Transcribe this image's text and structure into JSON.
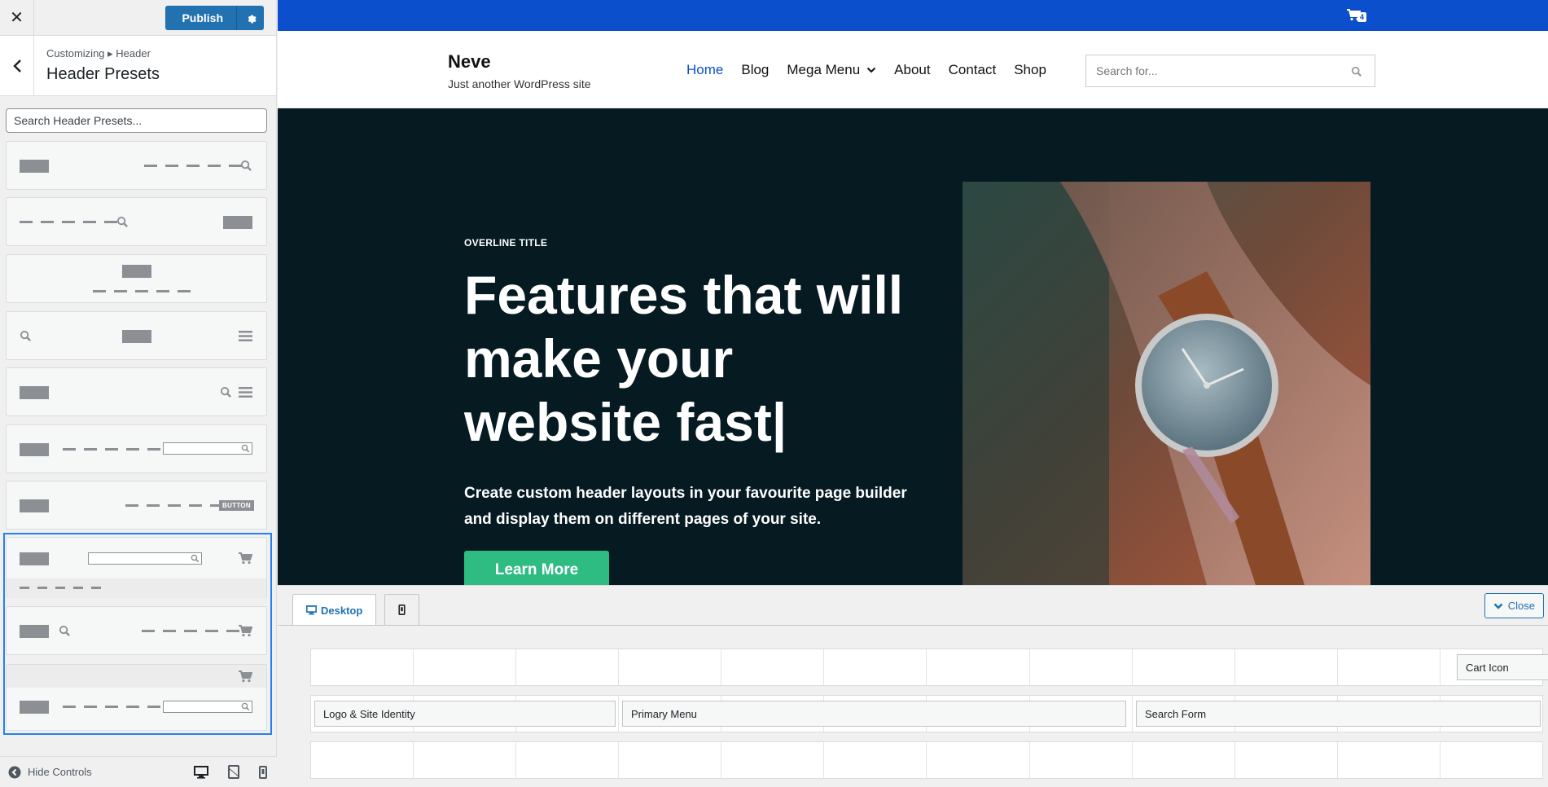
{
  "sidebar": {
    "publish_label": "Publish",
    "breadcrumb": "Customizing ▸ Header",
    "title": "Header Presets",
    "search_placeholder": "Search Header Presets...",
    "preset_button_label": "BUTTON",
    "hide_controls": "Hide Controls"
  },
  "preview": {
    "cart_count": "4",
    "site_title": "Neve",
    "site_tagline": "Just another WordPress site",
    "nav": [
      "Home",
      "Blog",
      "Mega Menu",
      "About",
      "Contact",
      "Shop"
    ],
    "search_placeholder": "Search for...",
    "overline": "OVERLINE TITLE",
    "hero_title": "Features that will make your website fast|",
    "hero_subtitle": "Create custom header layouts in your favourite page builder and display them on different pages of your site.",
    "cta": "Learn More"
  },
  "builder": {
    "tab_desktop": "Desktop",
    "close_label": "Close",
    "items": {
      "cart_icon": "Cart Icon",
      "logo": "Logo & Site Identity",
      "primary_menu": "Primary Menu",
      "search_form": "Search Form"
    }
  },
  "colors": {
    "accent": "#2271b1",
    "topbar": "#0b4fcc",
    "hero_bg": "#061a22",
    "cta": "#2ebc83",
    "selection": "#2680eb"
  }
}
